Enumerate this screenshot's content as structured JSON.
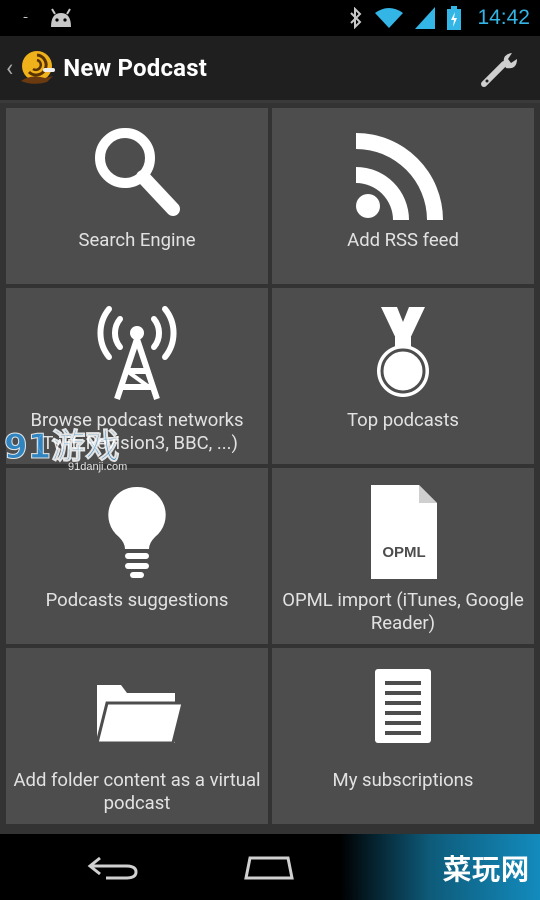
{
  "status_bar": {
    "time": "14:42",
    "icons": [
      "flash-icon",
      "android-debug-icon",
      "bluetooth-icon",
      "wifi-icon",
      "signal-icon",
      "battery-charging-icon"
    ]
  },
  "action_bar": {
    "title": "New Podcast",
    "icons": [
      "up-caret-icon",
      "app-logo-icon",
      "settings-wrench-icon"
    ]
  },
  "tiles": [
    {
      "label": "Search Engine",
      "icon": "search-icon"
    },
    {
      "label": "Add RSS feed",
      "icon": "rss-icon"
    },
    {
      "label": "Browse podcast networks (Twit, Revision3, BBC, ...)",
      "icon": "antenna-icon"
    },
    {
      "label": "Top podcasts",
      "icon": "medal-icon"
    },
    {
      "label": "Podcasts suggestions",
      "icon": "lightbulb-icon"
    },
    {
      "label": "OPML import (iTunes, Google Reader)",
      "icon": "opml-file-icon",
      "icon_text": "OPML"
    },
    {
      "label": "Add folder content as a virtual podcast",
      "icon": "folder-icon"
    },
    {
      "label": "My subscriptions",
      "icon": "document-list-icon"
    }
  ],
  "watermarks": {
    "left_text": "91游戏",
    "left_sub": "91danji.com",
    "right_text": "菜玩网"
  },
  "nav_bar": {
    "icons": [
      "back-icon",
      "home-icon"
    ]
  },
  "colors": {
    "background": "#333333",
    "tile": "#4d4d4d",
    "action_bar": "#1f1f1f",
    "status_accent": "#33b5e5"
  }
}
